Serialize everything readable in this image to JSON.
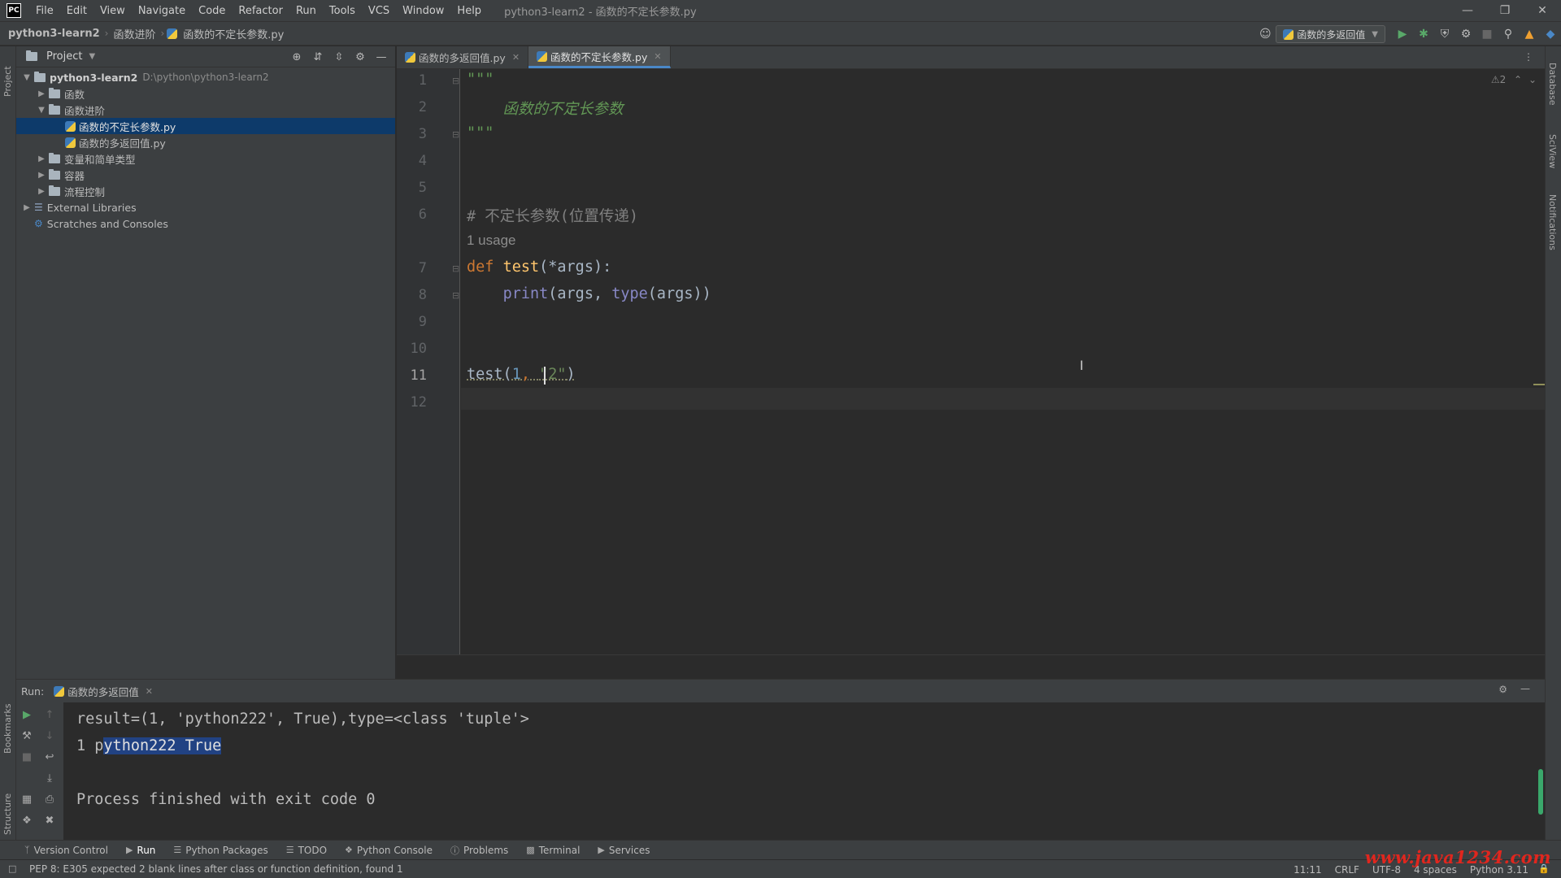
{
  "menubar": {
    "logo": "PC",
    "items": [
      "File",
      "Edit",
      "View",
      "Navigate",
      "Code",
      "Refactor",
      "Run",
      "Tools",
      "VCS",
      "Window",
      "Help"
    ],
    "window_title": "python3-learn2 - 函数的不定长参数.py"
  },
  "navbar": {
    "crumbs": [
      "python3-learn2",
      "函数进阶",
      "函数的不定长参数.py"
    ],
    "run_config": "函数的多返回值"
  },
  "left_stripe": {
    "project": "Project",
    "bookmarks": "Bookmarks",
    "structure": "Structure"
  },
  "right_stripe": {
    "database": "Database",
    "sciview": "SciView",
    "notifications": "Notifications"
  },
  "project": {
    "title": "Project",
    "root_name": "python3-learn2",
    "root_path": "D:\\python\\python3-learn2",
    "items": [
      {
        "label": "函数"
      },
      {
        "label": "函数进阶"
      },
      {
        "label": "函数的不定长参数.py"
      },
      {
        "label": "函数的多返回值.py"
      },
      {
        "label": "变量和简单类型"
      },
      {
        "label": "容器"
      },
      {
        "label": "流程控制"
      },
      {
        "label": "External Libraries"
      },
      {
        "label": "Scratches and Consoles"
      }
    ]
  },
  "editor": {
    "tabs": [
      {
        "label": "函数的多返回值.py",
        "active": false
      },
      {
        "label": "函数的不定长参数.py",
        "active": true
      }
    ],
    "line_numbers": [
      "1",
      "2",
      "3",
      "4",
      "5",
      "6",
      "7",
      "8",
      "9",
      "10",
      "11",
      "12"
    ],
    "code": {
      "l1": "\"\"\"",
      "l2": "    函数的不定长参数",
      "l3": "\"\"\"",
      "l6": "# 不定长参数(位置传递)",
      "usage_hint": "1 usage",
      "l7_kw": "def",
      "l7_fn": "test",
      "l7_rest": "(*args):",
      "l8_print": "print",
      "l8_mid": "(args, ",
      "l8_type": "type",
      "l8_end": "(args))",
      "l11_call": "test(",
      "l11_num": "1",
      "l11_sep": ", ",
      "l11_str": "\"2\"",
      "l11_end": ")"
    },
    "inspection": "⚠2"
  },
  "run_panel": {
    "label": "Run:",
    "tab": "函数的多返回值",
    "output": {
      "line1": "result=(1, 'python222', True),type=<class 'tuple'>",
      "line2_pre": "1 p",
      "line2_sel": "ython222 True",
      "line3": "Process finished with exit code 0"
    }
  },
  "tool_windows": [
    "Version Control",
    "Run",
    "Python Packages",
    "TODO",
    "Python Console",
    "Problems",
    "Terminal",
    "Services"
  ],
  "status": {
    "message": "PEP 8: E305 expected 2 blank lines after class or function definition, found 1",
    "position": "11:11",
    "line_sep": "CRLF",
    "encoding": "UTF-8",
    "indent": "4 spaces",
    "interpreter": "Python 3.11"
  },
  "watermark": "www.java1234.com"
}
